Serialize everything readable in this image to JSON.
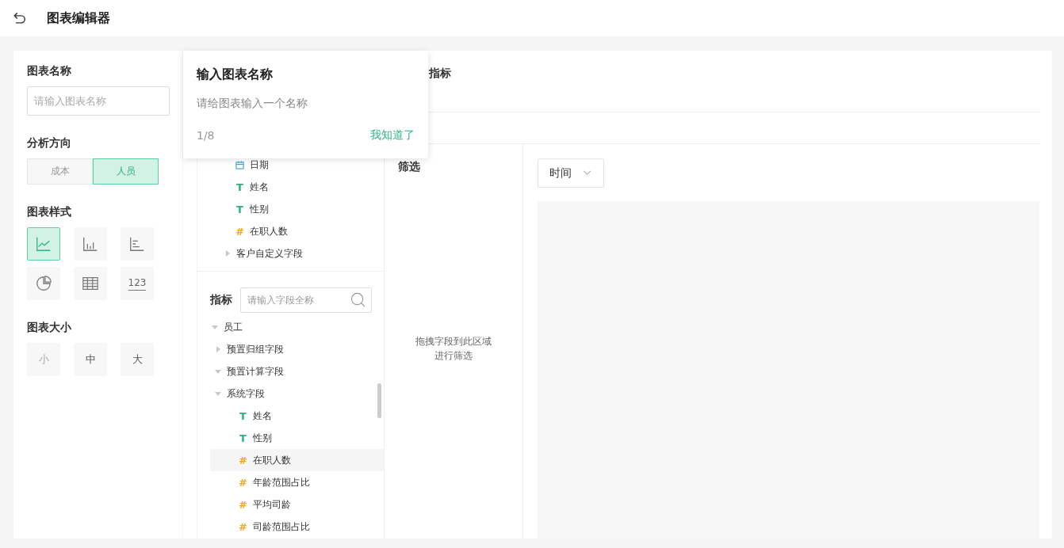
{
  "header": {
    "title": "图表编辑器"
  },
  "settings": {
    "name_label": "图表名称",
    "name_field": {
      "placeholder": "请输入图表名称"
    },
    "direction_label": "分析方向",
    "directions": [
      {
        "label": "成本",
        "selected": false
      },
      {
        "label": "人员",
        "selected": true
      }
    ],
    "style_label": "图表样式",
    "chart_styles": [
      {
        "kind": "line",
        "selected": true
      },
      {
        "kind": "bar",
        "selected": false
      },
      {
        "kind": "hbar",
        "selected": false
      },
      {
        "kind": "pie",
        "selected": false
      },
      {
        "kind": "table",
        "selected": false
      },
      {
        "kind": "number",
        "label": "123",
        "selected": false
      }
    ],
    "size_label": "图表大小",
    "sizes": [
      {
        "label": "小",
        "disabled": true
      },
      {
        "label": "中",
        "disabled": false
      },
      {
        "label": "大",
        "disabled": false
      }
    ]
  },
  "guide_popover": {
    "title": "输入图表名称",
    "body": "请给图表输入一个名称",
    "step": "1/8",
    "action": "我知道了"
  },
  "editor": {
    "metric_heading": "指标",
    "dimension_fields": [
      {
        "kind": "date",
        "label": "日期"
      },
      {
        "kind": "text",
        "icon": "T",
        "label": "姓名"
      },
      {
        "kind": "text",
        "icon": "T",
        "label": "性别"
      },
      {
        "kind": "number",
        "icon": "#",
        "label": "在职人数"
      },
      {
        "kind": "group",
        "label": "客户自定义字段",
        "expanded": false
      }
    ],
    "metric_label": "指标",
    "metric_search": {
      "placeholder": "请输入字段全称"
    },
    "metric_tree": [
      {
        "label": "员工",
        "expanded": true,
        "children": [
          {
            "label": "预置归组字段",
            "expanded": false
          },
          {
            "label": "预置计算字段",
            "expanded": true
          },
          {
            "label": "系统字段",
            "expanded": true,
            "children": [
              {
                "kind": "text",
                "icon": "T",
                "label": "姓名",
                "selected": false
              },
              {
                "kind": "text",
                "icon": "T",
                "label": "性别",
                "selected": false
              },
              {
                "kind": "number",
                "icon": "#",
                "label": "在职人数",
                "selected": true
              },
              {
                "kind": "number",
                "icon": "#",
                "label": "年龄范围占比",
                "selected": false
              },
              {
                "kind": "number",
                "icon": "#",
                "label": "平均司龄",
                "selected": false
              },
              {
                "kind": "number",
                "icon": "#",
                "label": "司龄范围占比",
                "selected": false
              }
            ]
          }
        ]
      }
    ],
    "filter": {
      "title": "筛选",
      "hint": "拖拽字段到此区域进行筛选"
    },
    "time_dropdown": {
      "value": "时间"
    }
  }
}
